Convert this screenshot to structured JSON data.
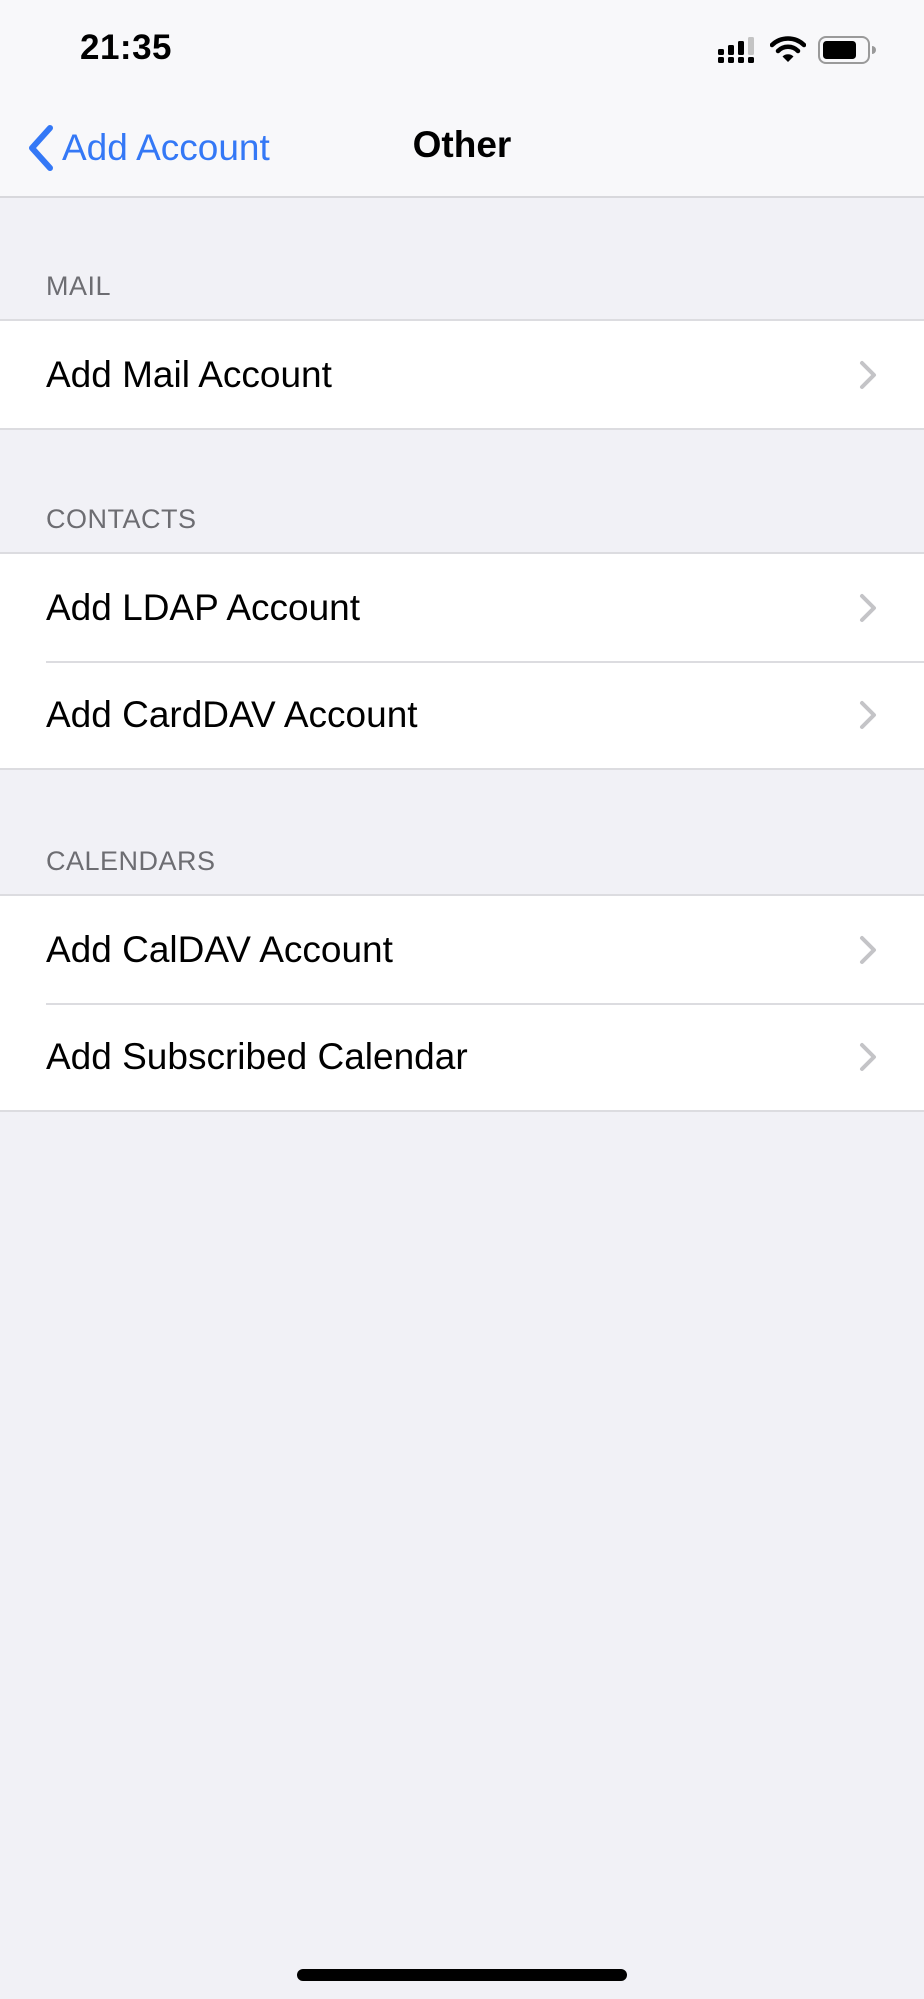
{
  "status_bar": {
    "time": "21:35",
    "icons": [
      "cellular-signal-icon",
      "wifi-icon",
      "battery-icon"
    ]
  },
  "nav": {
    "back_label": "Add Account",
    "title": "Other",
    "accent_color": "#3478f6"
  },
  "sections": [
    {
      "header": "MAIL",
      "items": [
        {
          "label": "Add Mail Account"
        }
      ]
    },
    {
      "header": "CONTACTS",
      "items": [
        {
          "label": "Add LDAP Account"
        },
        {
          "label": "Add CardDAV Account"
        }
      ]
    },
    {
      "header": "CALENDARS",
      "items": [
        {
          "label": "Add CalDAV Account"
        },
        {
          "label": "Add Subscribed Calendar"
        }
      ]
    }
  ]
}
